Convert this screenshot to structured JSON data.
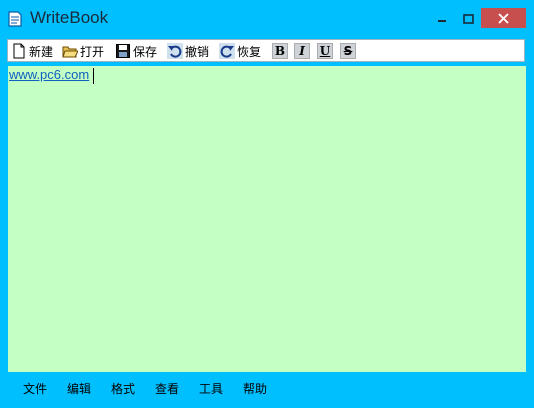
{
  "window": {
    "title": "WriteBook"
  },
  "toolbar": {
    "new_label": "新建",
    "open_label": "打开",
    "save_label": "保存",
    "undo_label": "撤销",
    "redo_label": "恢复",
    "bold_label": "B",
    "italic_label": "I",
    "underline_label": "U",
    "strike_label": "S"
  },
  "editor": {
    "content": "www.pc6.com",
    "background": "#c4ffc4",
    "link_color": "#1060c0"
  },
  "menubar": {
    "items": [
      {
        "label": "文件"
      },
      {
        "label": "编辑"
      },
      {
        "label": "格式"
      },
      {
        "label": "查看"
      },
      {
        "label": "工具"
      },
      {
        "label": "帮助"
      }
    ]
  },
  "colors": {
    "window_bg": "#00bfff",
    "close_button": "#c7504f"
  }
}
